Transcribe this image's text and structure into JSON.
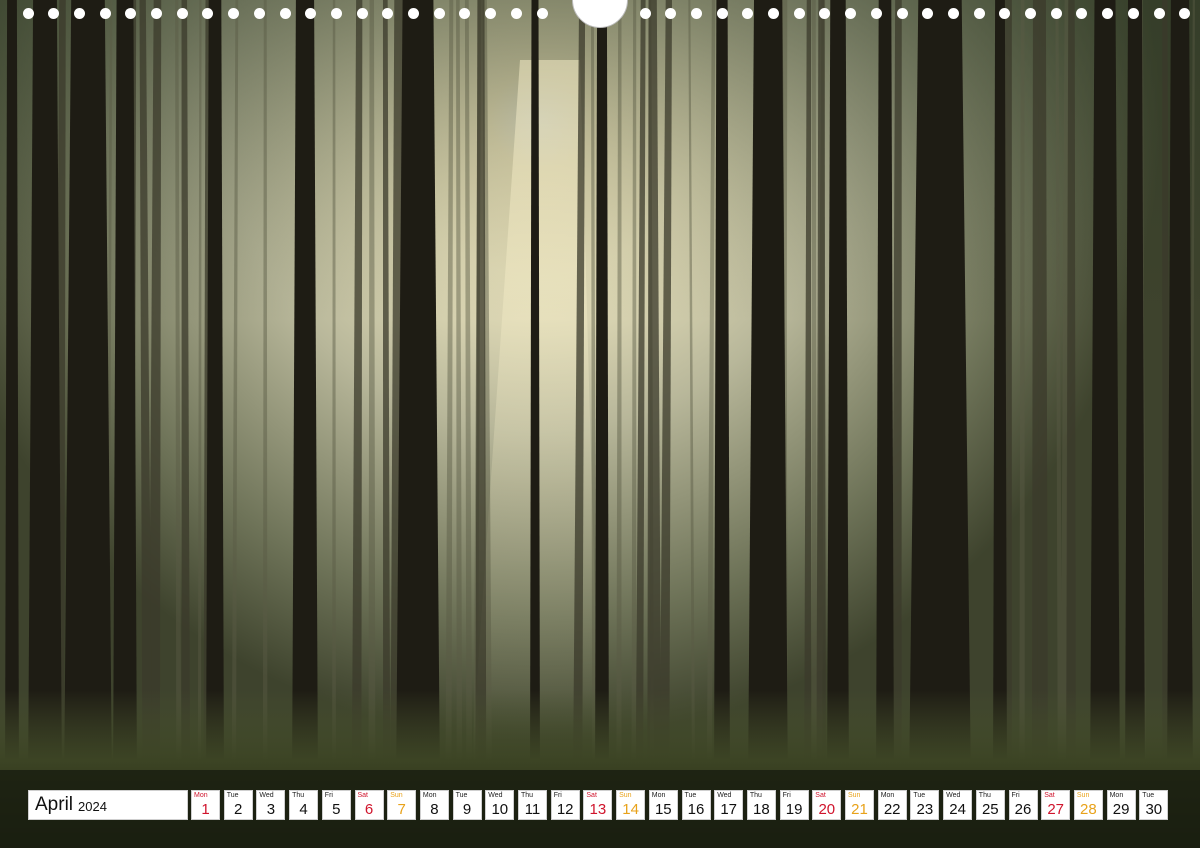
{
  "calendar": {
    "month": "April",
    "year": "2024",
    "days": [
      {
        "dow": "Mon",
        "num": "1",
        "kind": "hol"
      },
      {
        "dow": "Tue",
        "num": "2",
        "kind": "wd"
      },
      {
        "dow": "Wed",
        "num": "3",
        "kind": "wd"
      },
      {
        "dow": "Thu",
        "num": "4",
        "kind": "wd"
      },
      {
        "dow": "Fri",
        "num": "5",
        "kind": "wd"
      },
      {
        "dow": "Sat",
        "num": "6",
        "kind": "sat"
      },
      {
        "dow": "Sun",
        "num": "7",
        "kind": "sun"
      },
      {
        "dow": "Mon",
        "num": "8",
        "kind": "wd"
      },
      {
        "dow": "Tue",
        "num": "9",
        "kind": "wd"
      },
      {
        "dow": "Wed",
        "num": "10",
        "kind": "wd"
      },
      {
        "dow": "Thu",
        "num": "11",
        "kind": "wd"
      },
      {
        "dow": "Fri",
        "num": "12",
        "kind": "wd"
      },
      {
        "dow": "Sat",
        "num": "13",
        "kind": "sat"
      },
      {
        "dow": "Sun",
        "num": "14",
        "kind": "sun"
      },
      {
        "dow": "Mon",
        "num": "15",
        "kind": "wd"
      },
      {
        "dow": "Tue",
        "num": "16",
        "kind": "wd"
      },
      {
        "dow": "Wed",
        "num": "17",
        "kind": "wd"
      },
      {
        "dow": "Thu",
        "num": "18",
        "kind": "wd"
      },
      {
        "dow": "Fri",
        "num": "19",
        "kind": "wd"
      },
      {
        "dow": "Sat",
        "num": "20",
        "kind": "sat"
      },
      {
        "dow": "Sun",
        "num": "21",
        "kind": "sun"
      },
      {
        "dow": "Mon",
        "num": "22",
        "kind": "wd"
      },
      {
        "dow": "Tue",
        "num": "23",
        "kind": "wd"
      },
      {
        "dow": "Wed",
        "num": "24",
        "kind": "wd"
      },
      {
        "dow": "Thu",
        "num": "25",
        "kind": "wd"
      },
      {
        "dow": "Fri",
        "num": "26",
        "kind": "wd"
      },
      {
        "dow": "Sat",
        "num": "27",
        "kind": "sat"
      },
      {
        "dow": "Sun",
        "num": "28",
        "kind": "sun"
      },
      {
        "dow": "Mon",
        "num": "29",
        "kind": "wd"
      },
      {
        "dow": "Tue",
        "num": "30",
        "kind": "wd"
      }
    ]
  },
  "colors": {
    "saturday": "#d0142c",
    "sunday": "#e8a21a",
    "weekday": "#111111"
  },
  "photo": {
    "subject": "forest-icon"
  }
}
